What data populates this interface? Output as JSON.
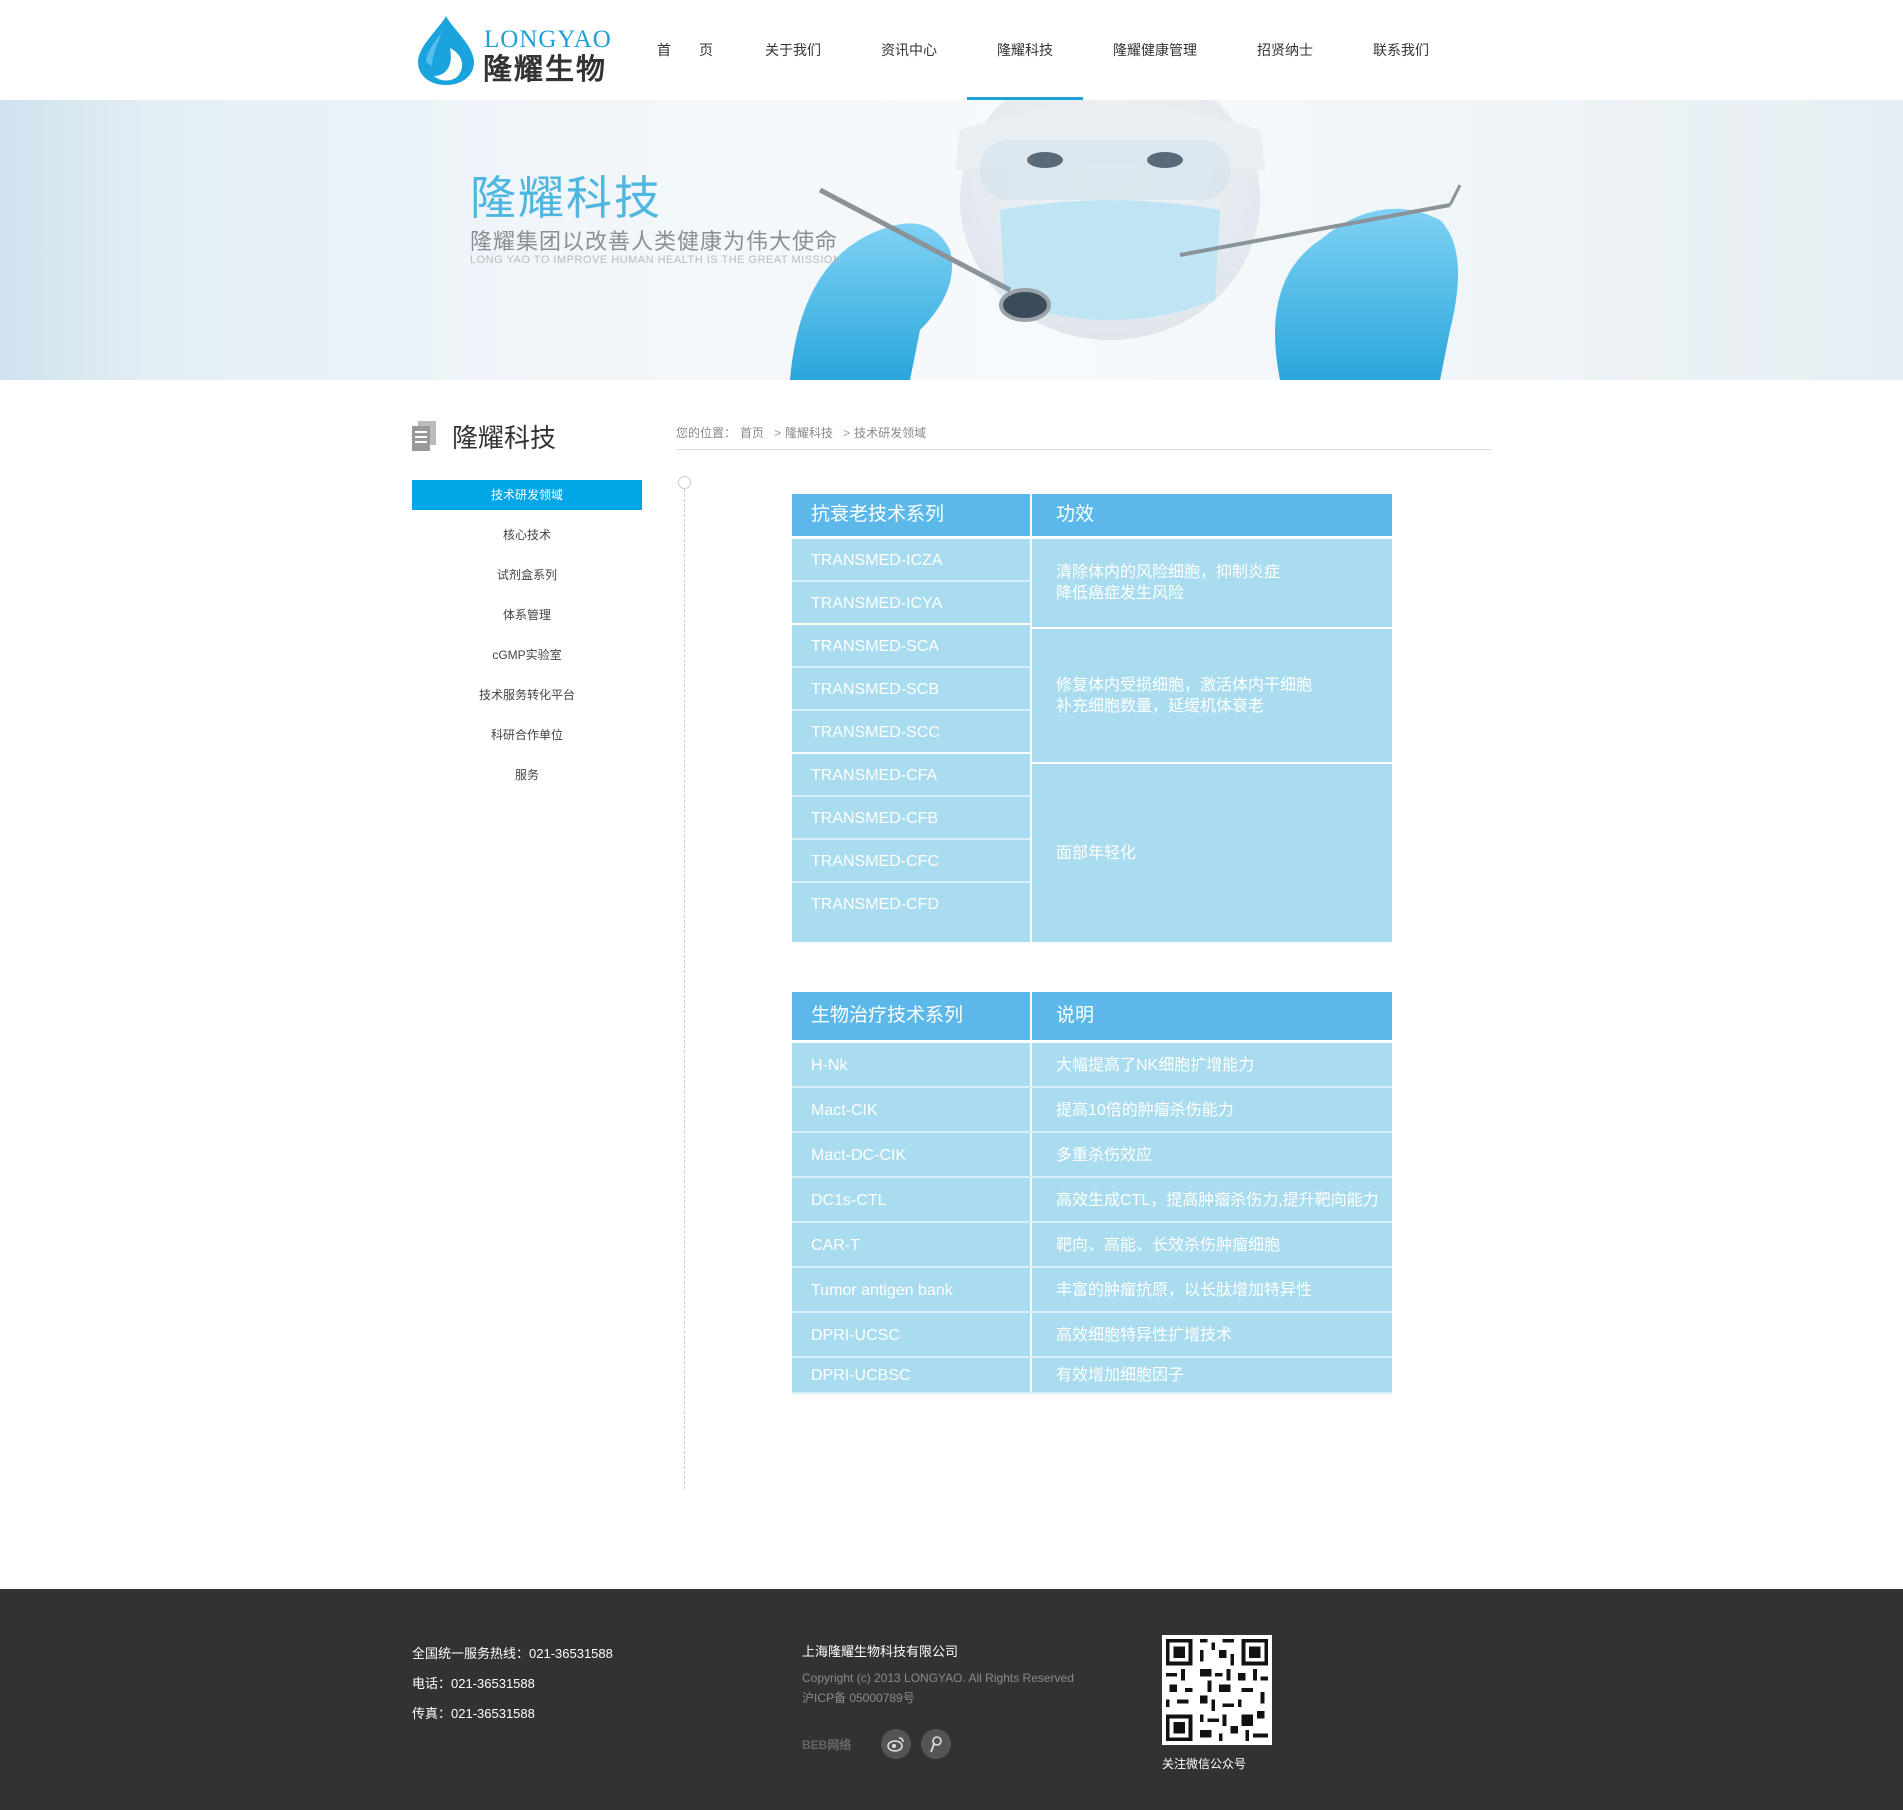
{
  "header": {
    "logo_en": "LONGYAO",
    "logo_cn": "隆耀生物",
    "nav": [
      {
        "label": "首　　页",
        "active": false
      },
      {
        "label": "关于我们",
        "active": false
      },
      {
        "label": "资讯中心",
        "active": false
      },
      {
        "label": "隆耀科技",
        "active": true
      },
      {
        "label": "隆耀健康管理",
        "active": false
      },
      {
        "label": "招贤纳士",
        "active": false
      },
      {
        "label": "联系我们",
        "active": false
      }
    ]
  },
  "banner": {
    "title": "隆耀科技",
    "subtitle": "隆耀集团以改善人类健康为伟大使命",
    "subtitle_en": "LONG YAO TO IMPROVE HUMAN HEALTH IS THE GREAT MISSION"
  },
  "sidebar": {
    "title": "隆耀科技",
    "items": [
      {
        "label": "技术研发领域",
        "active": true
      },
      {
        "label": "核心技术",
        "active": false
      },
      {
        "label": "试剂盒系列",
        "active": false
      },
      {
        "label": "体系管理",
        "active": false
      },
      {
        "label": "cGMP实验室",
        "active": false
      },
      {
        "label": "技术服务转化平台",
        "active": false
      },
      {
        "label": "科研合作单位",
        "active": false
      },
      {
        "label": "服务",
        "active": false
      }
    ]
  },
  "breadcrumb": {
    "prefix": "您的位置：",
    "items": [
      "首页",
      "隆耀科技",
      "技术研发领域"
    ],
    "sep": ">"
  },
  "table1": {
    "header": [
      "抗衰老技术系列",
      "功效"
    ],
    "groups": [
      {
        "items": [
          "TRANSMED-ICZA",
          "TRANSMED-ICYA"
        ],
        "effect_lines": [
          "清除体内的风险细胞，抑制炎症",
          "降低癌症发生风险"
        ]
      },
      {
        "items": [
          "TRANSMED-SCA",
          "TRANSMED-SCB",
          "TRANSMED-SCC"
        ],
        "effect_lines": [
          "修复体内受损细胞，激活体内干细胞",
          "补充细胞数量，延缓机体衰老"
        ]
      },
      {
        "items": [
          "TRANSMED-CFA",
          " TRANSMED-CFB",
          "TRANSMED-CFC",
          "TRANSMED-CFD"
        ],
        "effect_lines": [
          "面部年轻化"
        ]
      }
    ]
  },
  "table2": {
    "header": [
      "生物治疗技术系列",
      "说明"
    ],
    "rows": [
      [
        "H-Nk",
        "大幅提高了NK细胞扩增能力"
      ],
      [
        "Mact-CIK",
        "提高10倍的肿瘤杀伤能力"
      ],
      [
        "Mact-DC-CIK",
        "多重杀伤效应"
      ],
      [
        "DC1s-CTL",
        "高效生成CTL，提高肿瘤杀伤力,提升靶向能力"
      ],
      [
        "CAR-T",
        "靶向、高能、长效杀伤肿瘤细胞"
      ],
      [
        "Tumor antigen bank",
        "丰富的肿瘤抗原，以长肽增加特异性"
      ],
      [
        "DPRI-UCSC",
        "高效细胞特异性扩增技术"
      ],
      [
        "DPRI-UCBSC",
        "有效增加细胞因子"
      ]
    ]
  },
  "footer": {
    "hotline": "全国统一服务热线：021-36531588",
    "phone": "电话：021-36531588",
    "fax": "传真：021-36531588",
    "company": "上海隆耀生物科技有限公司",
    "copyright": "Copyright (c) 2013 LONGYAO. All Rights Reserved",
    "icp": "沪ICP备 05000789号",
    "beb": "BEB网络",
    "qr_label": "关注微信公众号"
  },
  "colors": {
    "accent": "#00a6e6",
    "table_head": "#5cb8e8",
    "table_body": "#a9dcee",
    "footer_bg": "#323232"
  }
}
